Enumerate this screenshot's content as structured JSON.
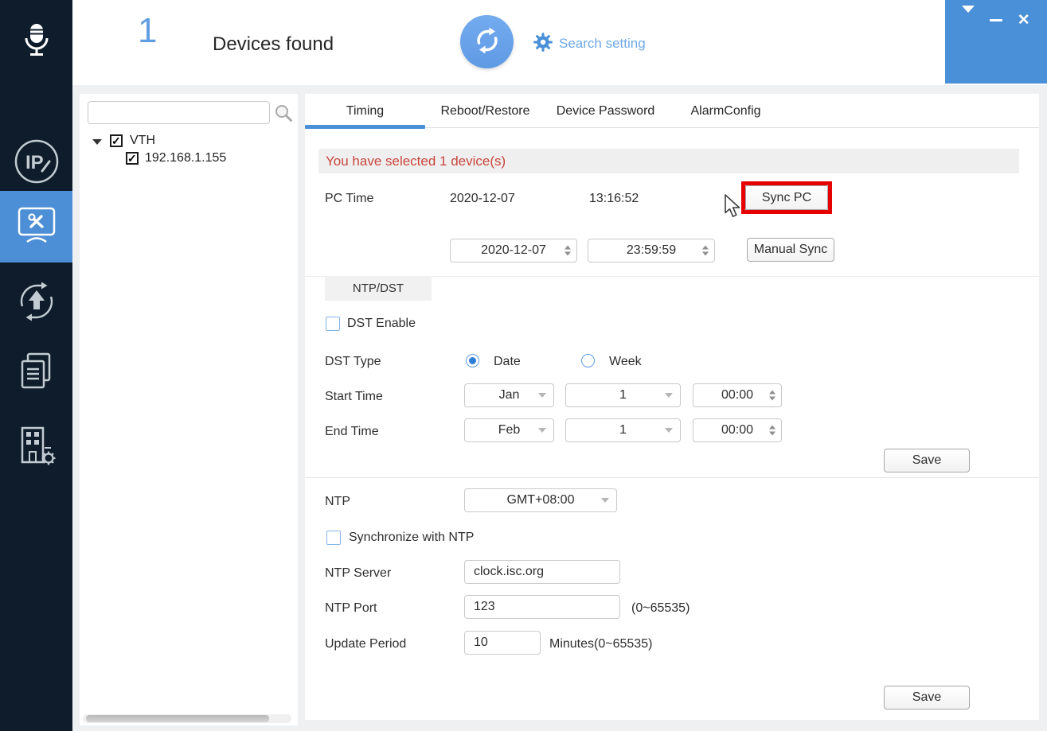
{
  "window": {
    "controls": [
      {
        "icon": "skin-icon"
      },
      {
        "icon": "minimize-icon"
      },
      {
        "icon": "close-icon",
        "glyph": "✕"
      }
    ]
  },
  "header": {
    "device_count": "1",
    "devices_found_label": "Devices found",
    "refresh_icon": "refresh-sync-icon",
    "search_setting_icon": "gear-icon",
    "search_setting_label": "Search setting"
  },
  "sidebar": {
    "items": [
      {
        "icon": "microphone-logo-icon",
        "active": false
      },
      {
        "icon": "ip-modify-icon",
        "active": false
      },
      {
        "icon": "device-config-icon",
        "active": true
      },
      {
        "icon": "upgrade-icon",
        "active": false
      },
      {
        "icon": "device-documents-icon",
        "active": false
      },
      {
        "icon": "building-config-icon",
        "active": false
      }
    ]
  },
  "device_tree": {
    "search_value": "",
    "search_icon": "magnifier-icon",
    "group_label": "VTH",
    "group_checked": true,
    "device_ip": "192.168.1.155",
    "device_checked": true
  },
  "tabs": {
    "items": [
      {
        "label": "Timing",
        "active": true
      },
      {
        "label": "Reboot/Restore",
        "active": false
      },
      {
        "label": "Device Password",
        "active": false
      },
      {
        "label": "AlarmConfig",
        "active": false
      }
    ]
  },
  "timing": {
    "selection_banner": "You have selected 1 device(s)",
    "pc_time_label": "PC Time",
    "pc_date": "2020-12-07",
    "pc_clock": "13:16:52",
    "sync_pc_button": "Sync PC",
    "manual_date": "2020-12-07",
    "manual_clock": "23:59:59",
    "manual_sync_button": "Manual Sync",
    "ntp_dst_tab": "NTP/DST",
    "dst_enable_label": "DST Enable",
    "dst_enabled": false,
    "dst_type_label": "DST Type",
    "dst_type_date": "Date",
    "dst_type_week": "Week",
    "dst_type_selected": "Date",
    "start_time_label": "Start Time",
    "start_month": "Jan",
    "start_day": "1",
    "start_clock": "00:00",
    "end_time_label": "End Time",
    "end_month": "Feb",
    "end_day": "1",
    "end_clock": "00:00",
    "dst_save_button": "Save",
    "ntp_label": "NTP",
    "ntp_timezone": "GMT+08:00",
    "sync_with_ntp_label": "Synchronize with NTP",
    "sync_with_ntp_checked": false,
    "ntp_server_label": "NTP Server",
    "ntp_server_value": "clock.isc.org",
    "ntp_port_label": "NTP Port",
    "ntp_port_value": "123",
    "ntp_port_range": "(0~65535)",
    "update_period_label": "Update Period",
    "update_period_value": "10",
    "update_period_unit": "Minutes(0~65535)",
    "ntp_save_button": "Save"
  },
  "colors": {
    "accent_blue": "#4a90d8",
    "light_blue": "#6fa8e8",
    "sidebar_bg": "#0e1c2b",
    "active_item_blue": "#4d8fd6",
    "alert_red": "#c9463d",
    "highlight_red": "#e60000",
    "banner_bg": "#efefef"
  }
}
